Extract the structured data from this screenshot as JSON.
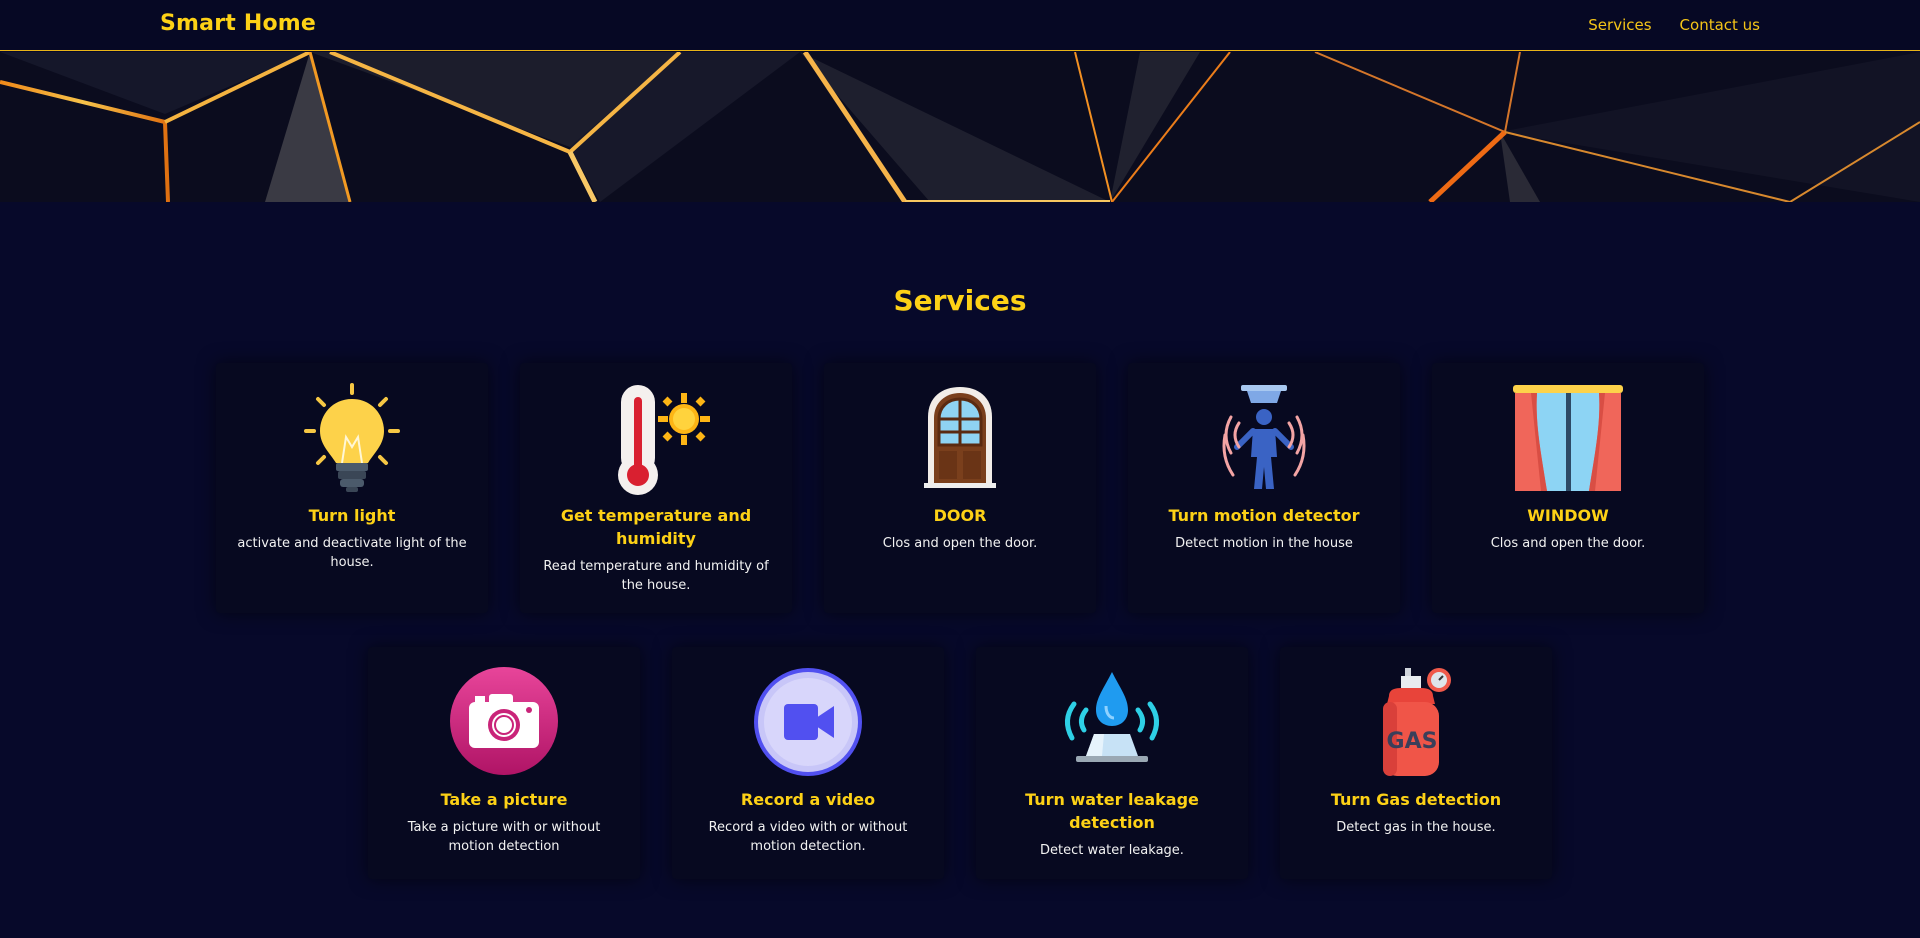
{
  "header": {
    "brand": "Smart Home",
    "nav": [
      {
        "label": "Services"
      },
      {
        "label": "Contact us"
      }
    ]
  },
  "colors": {
    "background": "#07092a",
    "accent": "#fdd116",
    "card": "#070920"
  },
  "services": {
    "title": "Services",
    "cards": [
      {
        "title": "Turn light",
        "description": "activate and deactivate light of the house.",
        "icon": "lightbulb-icon"
      },
      {
        "title": "Get temperature and humidity",
        "description": "Read temperature and humidity of the house.",
        "icon": "thermometer-sun-icon"
      },
      {
        "title": "DOOR",
        "description": "Clos and open the door.",
        "icon": "door-icon"
      },
      {
        "title": "Turn motion detector",
        "description": "Detect motion in the house",
        "icon": "motion-sensor-icon"
      },
      {
        "title": "WINDOW",
        "description": "Clos and open the door.",
        "icon": "window-curtain-icon"
      },
      {
        "title": "Take a picture",
        "description": "Take a picture with or without motion detection",
        "icon": "camera-icon"
      },
      {
        "title": "Record a video",
        "description": "Record a video with or without motion detection.",
        "icon": "video-camera-icon"
      },
      {
        "title": "Turn water leakage detection",
        "description": "Detect water leakage.",
        "icon": "water-leak-sensor-icon"
      },
      {
        "title": "Turn Gas detection",
        "description": "Detect gas in the house.",
        "icon": "gas-cylinder-icon",
        "icon_text": "GAS"
      }
    ]
  }
}
